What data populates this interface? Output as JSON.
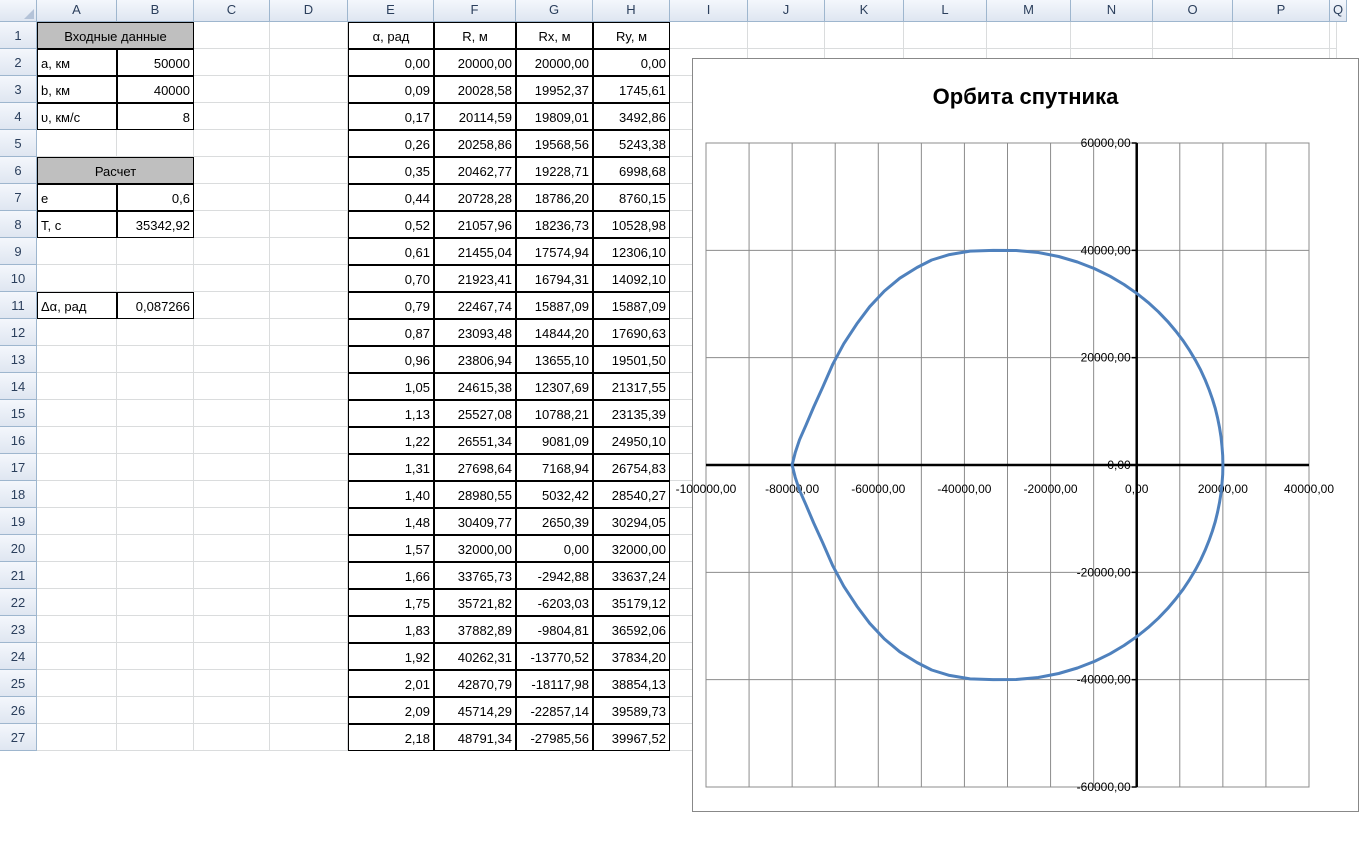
{
  "columns": [
    "A",
    "B",
    "C",
    "D",
    "E",
    "F",
    "G",
    "H",
    "I",
    "J",
    "K",
    "L",
    "M",
    "N",
    "O",
    "P",
    "Q"
  ],
  "rows": [
    "1",
    "2",
    "3",
    "4",
    "5",
    "6",
    "7",
    "8",
    "9",
    "10",
    "11",
    "12",
    "13",
    "14",
    "15",
    "16",
    "17",
    "18",
    "19",
    "20",
    "21",
    "22",
    "23",
    "24",
    "25",
    "26",
    "27"
  ],
  "input_section": {
    "header": "Входные данные",
    "items": [
      {
        "label": "a, км",
        "value": "50000"
      },
      {
        "label": "b, км",
        "value": "40000"
      },
      {
        "label": "υ, км/с",
        "value": "8"
      }
    ]
  },
  "calc_section": {
    "header": "Расчет",
    "items": [
      {
        "label": "e",
        "value": "0,6"
      },
      {
        "label": "T, с",
        "value": "35342,92"
      }
    ]
  },
  "delta": {
    "label": "Δα, рад",
    "value": "0,087266"
  },
  "table_headers": [
    "α, рад",
    "R, м",
    "Rx, м",
    "Ry, м"
  ],
  "table_rows": [
    [
      "0,00",
      "20000,00",
      "20000,00",
      "0,00"
    ],
    [
      "0,09",
      "20028,58",
      "19952,37",
      "1745,61"
    ],
    [
      "0,17",
      "20114,59",
      "19809,01",
      "3492,86"
    ],
    [
      "0,26",
      "20258,86",
      "19568,56",
      "5243,38"
    ],
    [
      "0,35",
      "20462,77",
      "19228,71",
      "6998,68"
    ],
    [
      "0,44",
      "20728,28",
      "18786,20",
      "8760,15"
    ],
    [
      "0,52",
      "21057,96",
      "18236,73",
      "10528,98"
    ],
    [
      "0,61",
      "21455,04",
      "17574,94",
      "12306,10"
    ],
    [
      "0,70",
      "21923,41",
      "16794,31",
      "14092,10"
    ],
    [
      "0,79",
      "22467,74",
      "15887,09",
      "15887,09"
    ],
    [
      "0,87",
      "23093,48",
      "14844,20",
      "17690,63"
    ],
    [
      "0,96",
      "23806,94",
      "13655,10",
      "19501,50"
    ],
    [
      "1,05",
      "24615,38",
      "12307,69",
      "21317,55"
    ],
    [
      "1,13",
      "25527,08",
      "10788,21",
      "23135,39"
    ],
    [
      "1,22",
      "26551,34",
      "9081,09",
      "24950,10"
    ],
    [
      "1,31",
      "27698,64",
      "7168,94",
      "26754,83"
    ],
    [
      "1,40",
      "28980,55",
      "5032,42",
      "28540,27"
    ],
    [
      "1,48",
      "30409,77",
      "2650,39",
      "30294,05"
    ],
    [
      "1,57",
      "32000,00",
      "0,00",
      "32000,00"
    ],
    [
      "1,66",
      "33765,73",
      "-2942,88",
      "33637,24"
    ],
    [
      "1,75",
      "35721,82",
      "-6203,03",
      "35179,12"
    ],
    [
      "1,83",
      "37882,89",
      "-9804,81",
      "36592,06"
    ],
    [
      "1,92",
      "40262,31",
      "-13770,52",
      "37834,20"
    ],
    [
      "2,01",
      "42870,79",
      "-18117,98",
      "38854,13"
    ],
    [
      "2,09",
      "45714,29",
      "-22857,14",
      "39589,73"
    ],
    [
      "2,18",
      "48791,34",
      "-27985,56",
      "39967,52"
    ]
  ],
  "chart_data": {
    "type": "scatter",
    "title": "Орбита спутника",
    "xlim": [
      -100000,
      40000
    ],
    "ylim": [
      -60000,
      60000
    ],
    "x_ticks": [
      -100000,
      -80000,
      -60000,
      -40000,
      -20000,
      0,
      20000,
      40000
    ],
    "y_ticks": [
      -60000,
      -40000,
      -20000,
      0,
      20000,
      40000,
      60000
    ],
    "x_tick_labels": [
      "-100000,00",
      "-80000,00",
      "-60000,00",
      "-40000,00",
      "-20000,00",
      "0,00",
      "20000,00",
      "40000,00"
    ],
    "y_tick_labels": [
      "-60000,00",
      "-40000,00",
      "-20000,00",
      "0,00",
      "20000,00",
      "40000,00",
      "60000,00"
    ],
    "grid": true,
    "series": [
      {
        "color": "#4f81bd",
        "smooth": true,
        "x": [
          20000,
          19952.37,
          19809.01,
          19568.56,
          19228.71,
          18786.2,
          18236.73,
          17574.94,
          16794.31,
          15887.09,
          14844.2,
          13655.1,
          12307.69,
          10788.21,
          9081.09,
          7168.94,
          5032.42,
          2650.39,
          0,
          -2942.88,
          -6203.03,
          -9804.81,
          -13770.52,
          -18117.98,
          -22857.14,
          -27985.56,
          -33333,
          -38681,
          -43500,
          -47600,
          -51000,
          -55000,
          -58600,
          -62000,
          -65000,
          -68000,
          -70600,
          -72900,
          -75000,
          -76800,
          -78300,
          -79300,
          -80000,
          -79300,
          -78300,
          -76800,
          -75000,
          -72900,
          -70600,
          -68000,
          -65000,
          -62000,
          -58600,
          -55000,
          -51000,
          -47600,
          -43500,
          -38681,
          -33333,
          -27985.56,
          -22857.14,
          -18117.98,
          -13770.52,
          -9804.81,
          -6203.03,
          -2942.88,
          0,
          2650.39,
          5032.42,
          7168.94,
          9081.09,
          10788.21,
          12307.69,
          13655.1,
          14844.2,
          15887.09,
          16794.31,
          17574.94,
          18236.73,
          18786.2,
          19228.71,
          19568.56,
          19809.01,
          19952.37,
          20000
        ],
        "y": [
          0,
          1745.61,
          3492.86,
          5243.38,
          6998.68,
          8760.15,
          10528.98,
          12306.1,
          14092.1,
          15887.09,
          17690.63,
          19501.5,
          21317.55,
          23135.39,
          24950.1,
          26754.83,
          28540.27,
          30294.05,
          32000,
          33637.24,
          35179.12,
          36592.06,
          37834.2,
          38854.13,
          39589.73,
          39967.52,
          39994,
          39850,
          39200,
          38200,
          36800,
          34800,
          32400,
          29500,
          26300,
          22600,
          18700,
          14500,
          10800,
          7400,
          4700,
          2300,
          0,
          -2300,
          -4700,
          -7400,
          -10800,
          -14500,
          -18700,
          -22600,
          -26300,
          -29500,
          -32400,
          -34800,
          -36800,
          -38200,
          -39200,
          -39850,
          -39994,
          -39967.52,
          -39589.73,
          -38854.13,
          -37834.2,
          -36592.06,
          -35179.12,
          -33637.24,
          -32000,
          -30294.05,
          -28540.27,
          -26754.83,
          -24950.1,
          -23135.39,
          -21317.55,
          -19501.5,
          -17690.63,
          -15887.09,
          -14092.1,
          -12306.1,
          -10528.98,
          -8760.15,
          -6998.68,
          -5243.38,
          -3492.86,
          -1745.61,
          0
        ]
      }
    ]
  }
}
